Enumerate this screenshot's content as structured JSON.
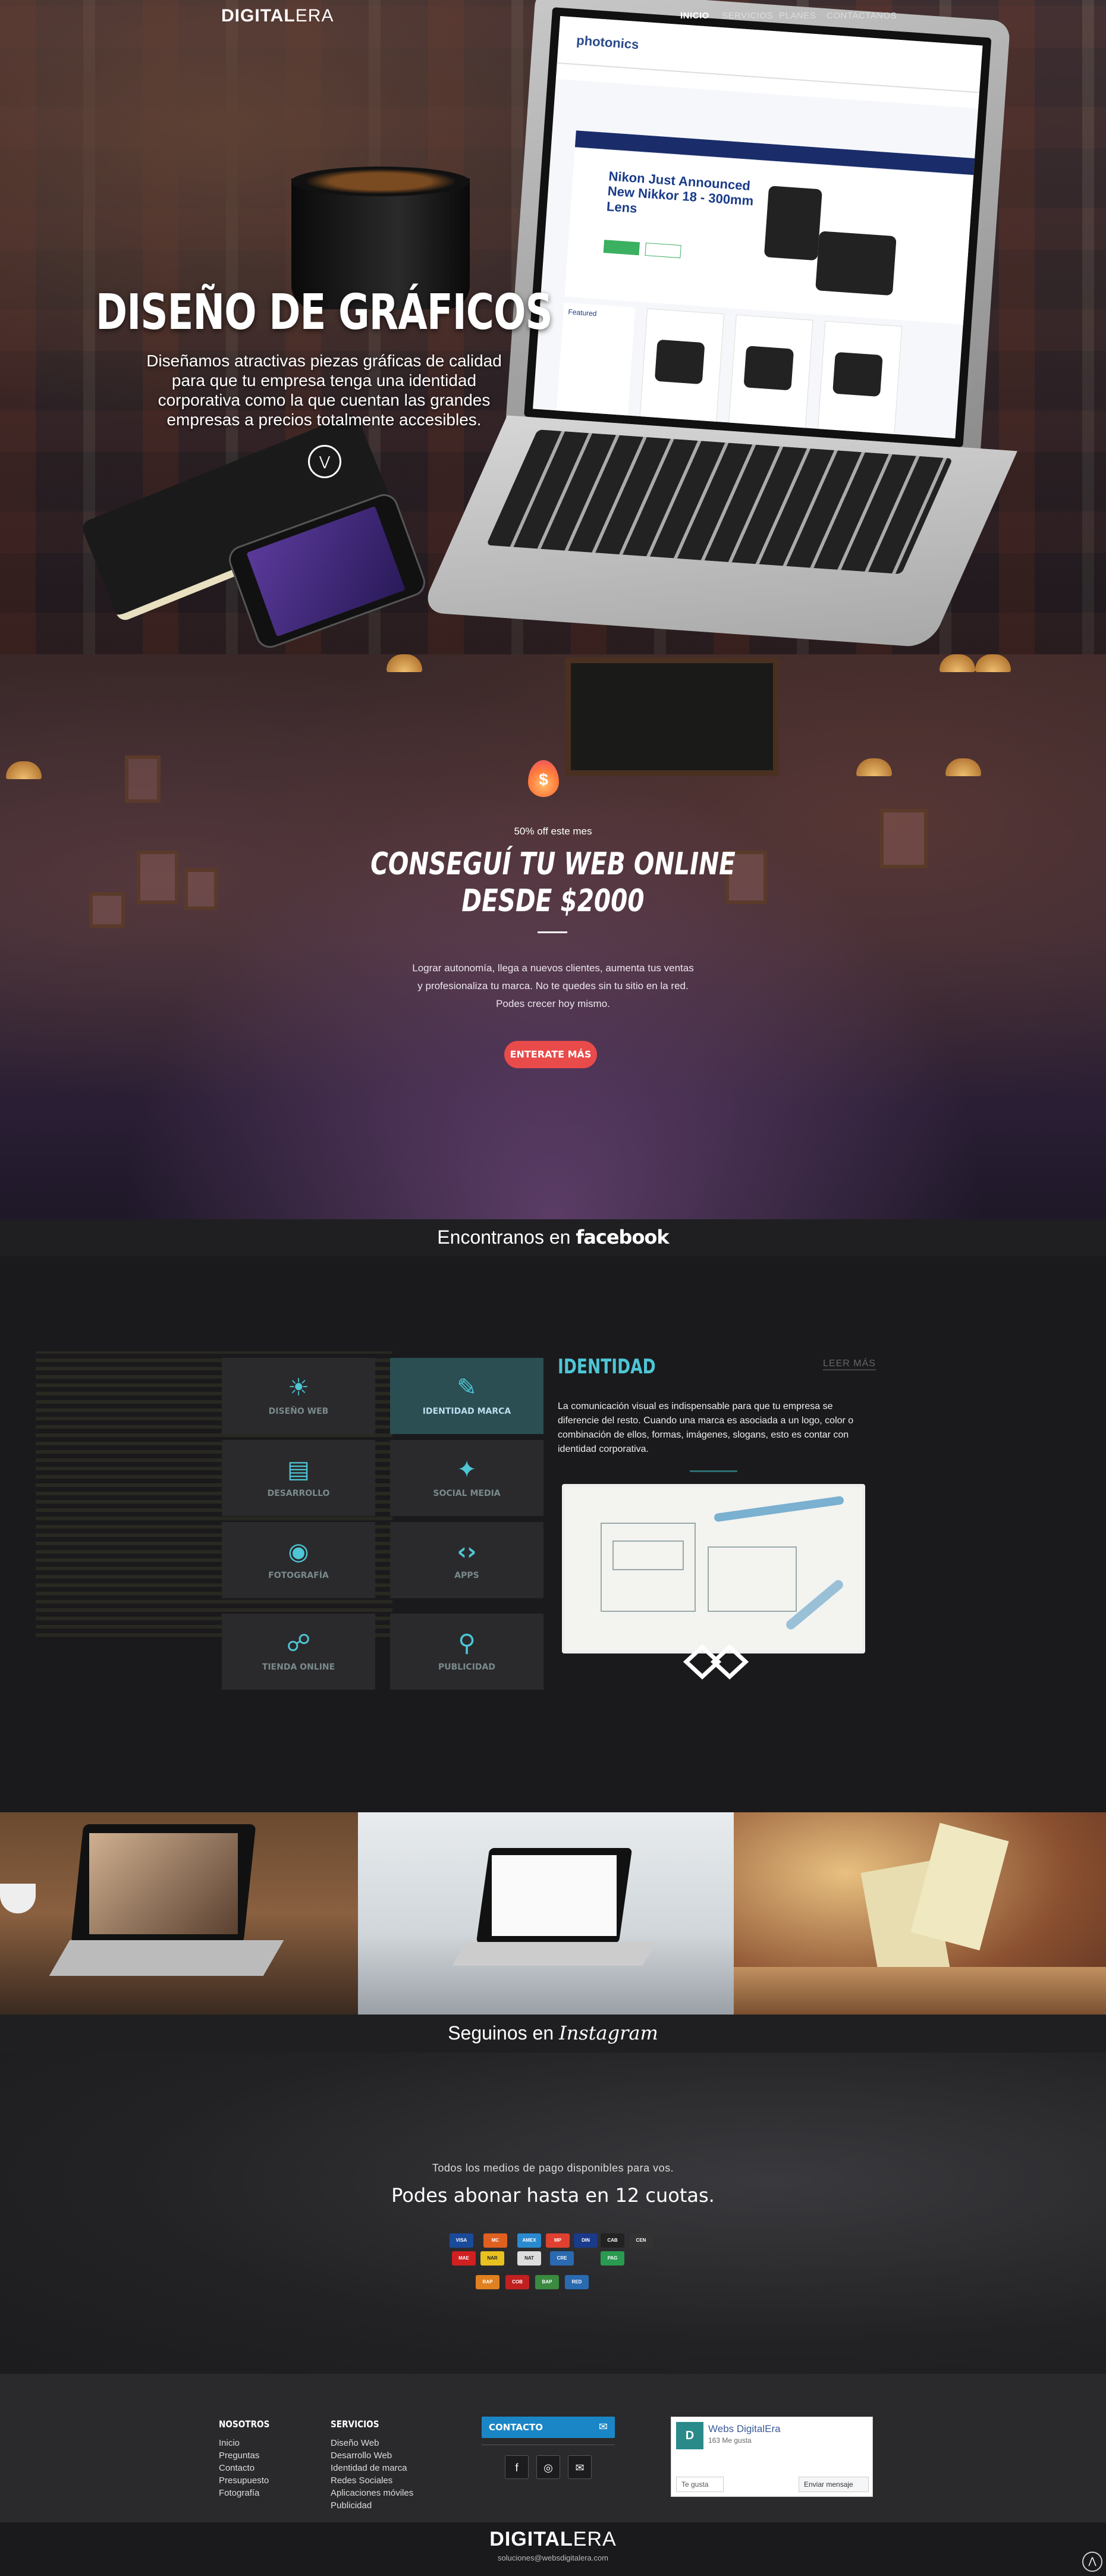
{
  "nav": {
    "logo_bold": "DIGITAL",
    "logo_light": "ERA",
    "items": [
      "INICIO",
      "SERVICIOS",
      "PLANES",
      "CONTACTANOS"
    ]
  },
  "hero": {
    "title": "DISEÑO DE GRÁFICOS",
    "subtitle": "Diseñamos atractivas piezas gráficas de calidad para que tu empresa tenga una identidad corporativa como la que cuentan las grandes empresas a precios totalmente accesibles.",
    "scroll_icon": "chevron-double-down-icon",
    "screen": {
      "brand": "photonics",
      "headline": "Nikon Just Announced New Nikkor 18 - 300mm Lens",
      "featured": "Featured"
    }
  },
  "promo": {
    "flame_symbol": "$",
    "off": "50% off este mes",
    "title_line1": "CONSEGUÍ TU WEB ONLINE",
    "title_line2": "DESDE $2000",
    "text": "Lograr autonomía, llega a nuevos clientes, aumenta tus ventas y profesionaliza tu marca. No te quedes sin tu sitio en la red. Podes crecer hoy mismo.",
    "button": "ENTERATE MÁS"
  },
  "facebook_bar": {
    "prefix": "Encontranos en",
    "brand": "facebook"
  },
  "services": {
    "items": [
      {
        "label": "DISEÑO WEB",
        "icon": "lightbulb-icon"
      },
      {
        "label": "IDENTIDAD MARCA",
        "icon": "pencil-edit-icon"
      },
      {
        "label": "DESARROLLO",
        "icon": "monitor-icon"
      },
      {
        "label": "SOCIAL MEDIA",
        "icon": "share-network-icon"
      },
      {
        "label": "FOTOGRAFÍA",
        "icon": "camera-icon"
      },
      {
        "label": "APPS",
        "icon": "code-icon"
      },
      {
        "label": "TIENDA ONLINE",
        "icon": "cart-icon"
      },
      {
        "label": "PUBLICIDAD",
        "icon": "ad-search-icon"
      }
    ],
    "active_index": 1,
    "detail_title": "IDENTIDAD",
    "read_more": "LEER MÁS",
    "detail_text": "La comunicación visual es indispensable para que tu empresa se diferencie del resto. Cuando una marca es asociada a un logo, color o combinación de ellos, formas, imágenes, slogans, esto es contar con identidad corporativa."
  },
  "instagram_bar": {
    "prefix": "Seguinos en",
    "brand": "Instagram"
  },
  "payments": {
    "subtitle": "Todos los medios de pago disponibles para vos.",
    "title": "Podes abonar hasta en 12 cuotas.",
    "methods": [
      "VISA",
      "MC",
      "AMEX",
      "MP",
      "DIN",
      "CAB",
      "CEN",
      "MAE",
      "NAR",
      "NAT",
      "CRE",
      "PAG",
      "RAP",
      "COB",
      "BAP",
      "RED"
    ]
  },
  "footer": {
    "col1": {
      "heading": "NOSOTROS",
      "links": [
        "Inicio",
        "Preguntas",
        "Contacto",
        "Presupuesto",
        "Fotografía"
      ]
    },
    "col2": {
      "heading": "SERVICIOS",
      "links": [
        "Diseño Web",
        "Desarrollo Web",
        "Identidad de marca",
        "Redes Sociales",
        "Aplicaciones móviles",
        "Publicidad"
      ]
    },
    "contact": "CONTACTO",
    "social_icons": [
      "facebook-icon",
      "instagram-icon",
      "mail-icon"
    ],
    "fb_widget": {
      "name": "Webs DigitalEra",
      "likes": "163 Me gusta",
      "like_btn": "Te gusta",
      "msg_btn": "Enviar mensaje"
    },
    "logo_bold": "DIGITAL",
    "logo_light": "ERA",
    "email": "soluciones@websdigitalera.com"
  },
  "colors": {
    "accent": "#4ec6d6",
    "cta": "#e94a4a",
    "contact": "#1a86c6"
  }
}
